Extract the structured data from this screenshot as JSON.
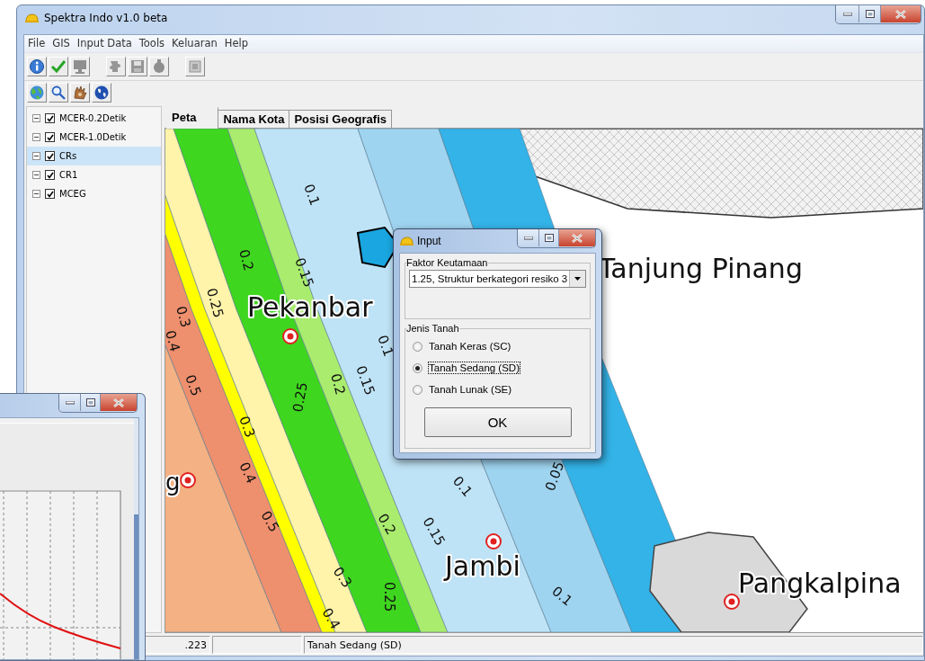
{
  "window": {
    "title": "Spektra Indo v1.0 beta"
  },
  "menu": [
    "File",
    "GIS",
    "Input Data",
    "Tools",
    "Keluaran",
    "Help"
  ],
  "toolbar_1": [
    {
      "kind": "info",
      "disabled": false
    },
    {
      "kind": "check",
      "disabled": false
    },
    {
      "kind": "monitor",
      "disabled": true
    },
    {
      "kind": "puzzle",
      "disabled": true
    },
    {
      "kind": "save",
      "disabled": true
    },
    {
      "kind": "pot",
      "disabled": true
    },
    {
      "kind": "frame",
      "disabled": true
    }
  ],
  "toolbar_2": [
    {
      "kind": "globe"
    },
    {
      "kind": "search"
    },
    {
      "kind": "hand"
    },
    {
      "kind": "earth"
    }
  ],
  "layers": [
    {
      "name": "MCER-0.2Detik",
      "expanded": true,
      "checked": true,
      "selected": false
    },
    {
      "name": "MCER-1.0Detik",
      "expanded": true,
      "checked": true,
      "selected": false
    },
    {
      "name": "CRs",
      "expanded": true,
      "checked": true,
      "selected": true
    },
    {
      "name": "CR1",
      "expanded": true,
      "checked": true,
      "selected": false
    },
    {
      "name": "MCEG",
      "expanded": true,
      "checked": true,
      "selected": false
    }
  ],
  "tabs": [
    {
      "label": "Peta",
      "selected": true
    },
    {
      "label": "Nama Kota",
      "selected": false
    },
    {
      "label": "Posisi Geografis",
      "selected": false
    }
  ],
  "map": {
    "cities": [
      "Tanjung Pinang",
      "Pekanbar",
      "Jambi",
      "Pangkalpina",
      "g"
    ],
    "contour_labels": [
      "0.1",
      "0.2",
      "0.15",
      "0.25",
      "0.3",
      "0.1",
      "0.2",
      "0.15",
      "0.25",
      "0.3",
      "0.5",
      "0.4",
      "0.5",
      "0.2",
      "0.15",
      "0.1",
      "0.05",
      "0.3",
      "0.25",
      "0.4",
      "0.1",
      "0.4"
    ]
  },
  "status_bar": [
    ".223",
    "Tanah Sedang (SD)"
  ],
  "dialog": {
    "title": "Input",
    "group_1": "Faktor Keutamaan",
    "select_value": "1.25, Struktur berkategori resiko 3",
    "group_2": "Jenis Tanah",
    "options": [
      {
        "label": "Tanah Keras (SC)",
        "selected": false
      },
      {
        "label": "Tanah Sedang (SD)",
        "selected": true
      },
      {
        "label": "Tanah Lunak (SE)",
        "selected": false
      }
    ],
    "button": "OK"
  }
}
